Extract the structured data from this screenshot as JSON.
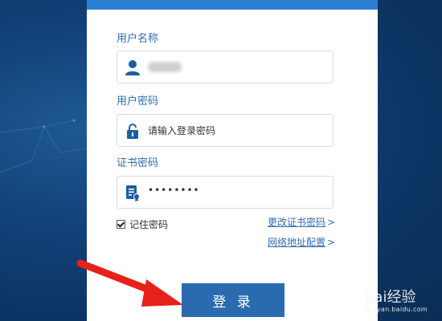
{
  "form": {
    "username_label": "用户名称",
    "password_label": "用户密码",
    "password_placeholder": "请输入登录密码",
    "cert_label": "证书密码",
    "cert_value": "••••••••",
    "remember_label": "记住密码",
    "remember_checked": true,
    "change_cert_link": "更改证书密码",
    "network_link": "网络地址配置",
    "link_chevron": ">",
    "login_button": "登 录"
  },
  "icons": {
    "username": "user-icon",
    "password": "lock-icon",
    "cert": "certificate-icon",
    "annotation": "red-arrow-icon"
  },
  "watermark": {
    "brand": "Bai经验",
    "url": "jingyan.baidu.com"
  },
  "colors": {
    "accent": "#2a7fd4",
    "label": "#2f6fb2",
    "button": "#2a6bb0",
    "background": "#0f3c6e",
    "arrow": "#e8201c"
  }
}
